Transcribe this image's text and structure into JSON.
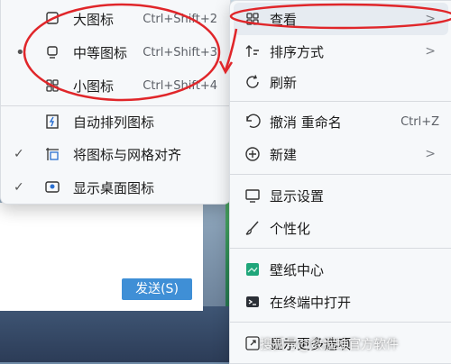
{
  "submenu": {
    "items": [
      {
        "icon": "large-icons-icon",
        "label": "大图标",
        "shortcut": "Ctrl+Shift+2",
        "selected": false
      },
      {
        "icon": "medium-icons-icon",
        "label": "中等图标",
        "shortcut": "Ctrl+Shift+3",
        "selected": true
      },
      {
        "icon": "small-icons-icon",
        "label": "小图标",
        "shortcut": "Ctrl+Shift+4",
        "selected": false
      },
      {
        "icon": "auto-arrange-icon",
        "label": "自动排列图标",
        "checked": false
      },
      {
        "icon": "align-grid-icon",
        "label": "将图标与网格对齐",
        "checked": true
      },
      {
        "icon": "show-desktop-icons-icon",
        "label": "显示桌面图标",
        "checked": true
      }
    ],
    "selected_mark": "•",
    "check_mark": "✓"
  },
  "mainmenu": {
    "items": [
      {
        "icon": "view-grid-icon",
        "label": "查看",
        "arrow": ">"
      },
      {
        "icon": "sort-icon",
        "label": "排序方式",
        "arrow": ">"
      },
      {
        "icon": "refresh-icon",
        "label": "刷新"
      },
      {
        "icon": "undo-icon",
        "label": "撤消 重命名",
        "shortcut": "Ctrl+Z"
      },
      {
        "icon": "new-icon",
        "label": "新建",
        "arrow": ">"
      },
      {
        "icon": "display-settings-icon",
        "label": "显示设置"
      },
      {
        "icon": "personalize-brush-icon",
        "label": "个性化"
      },
      {
        "icon": "wallpaper-center-icon",
        "label": "壁纸中心"
      },
      {
        "icon": "terminal-icon",
        "label": "在终端中打开"
      },
      {
        "icon": "more-options-icon",
        "label": "显示更多选项"
      }
    ]
  },
  "background": {
    "send_button": "发送(S)"
  },
  "watermark": "搜狐号@数据蛙官方软件",
  "colors": {
    "annotation": "#e0262a",
    "highlight": "#e6ebf1",
    "menu_bg": "#f6f8fa"
  }
}
